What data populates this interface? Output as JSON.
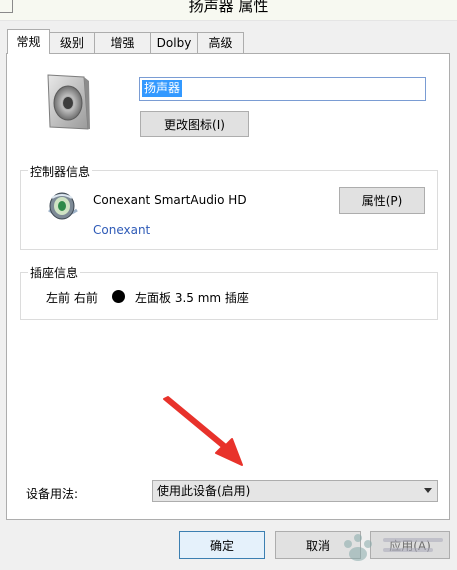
{
  "window": {
    "title": "扬声器 属性"
  },
  "tabs": [
    {
      "label": "常规",
      "active": true
    },
    {
      "label": "级别",
      "active": false
    },
    {
      "label": "增强",
      "active": false
    },
    {
      "label": "Dolby",
      "active": false
    },
    {
      "label": "高级",
      "active": false
    }
  ],
  "device": {
    "name": "扬声器",
    "change_icon_label": "更改图标(I)"
  },
  "controller": {
    "group_label": "控制器信息",
    "name": "Conexant SmartAudio HD",
    "vendor_link": "Conexant",
    "properties_label": "属性(P)"
  },
  "jack": {
    "group_label": "插座信息",
    "channels": "左前 右前",
    "location": "左面板 3.5 mm 插座"
  },
  "usage": {
    "label": "设备用法:",
    "selected": "使用此设备(启用)"
  },
  "buttons": {
    "ok": "确定",
    "cancel": "取消",
    "apply": "应用(A)"
  },
  "colors": {
    "accent": "#3399ff",
    "link": "#2f5bb7",
    "annotation_arrow": "#e8322b",
    "default_button_border": "#3c7fb1"
  }
}
